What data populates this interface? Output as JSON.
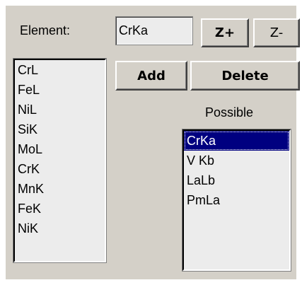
{
  "element_label": "Element:",
  "element_input_value": "CrKa",
  "buttons": {
    "z_plus": "Z+",
    "z_minus": "Z-",
    "add": "Add",
    "delete": "Delete"
  },
  "possible_label": "Possible",
  "element_list": {
    "items": [
      "CrL",
      "FeL",
      "NiL",
      "SiK",
      "MoL",
      "CrK",
      "MnK",
      "FeK",
      "NiK"
    ]
  },
  "possible_list": {
    "selected_index": 0,
    "items": [
      "CrKa",
      "V Kb",
      "LaLb",
      "PmLa"
    ]
  },
  "colors": {
    "panel_bg": "#d4d0c8",
    "list_bg": "#ececec",
    "selection_bg": "#000080",
    "selection_text": "#ffffff"
  }
}
